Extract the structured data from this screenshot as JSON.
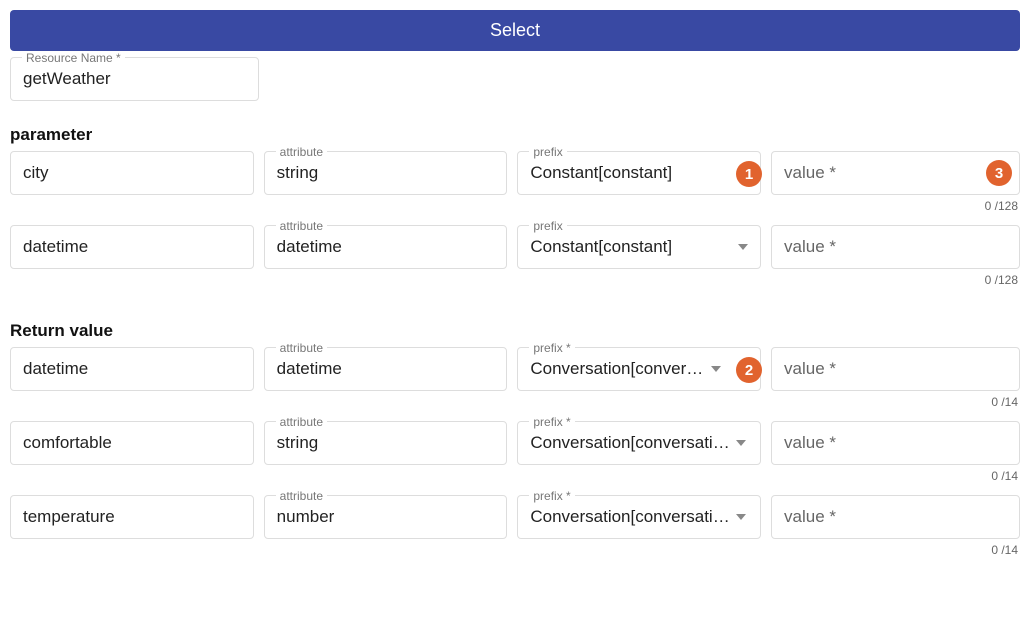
{
  "header": {
    "select_label": "Select"
  },
  "resource": {
    "label": "Resource Name *",
    "value": "getWeather"
  },
  "sections": {
    "parameter_title": "parameter",
    "return_title": "Return value"
  },
  "labels": {
    "attribute": "attribute",
    "prefix": "prefix",
    "prefix_req": "prefix *",
    "value_placeholder": "value *"
  },
  "parameters": [
    {
      "name": "city",
      "attribute": "string",
      "prefix": "Constant[constant]",
      "value": "",
      "counter": "0 /128"
    },
    {
      "name": "datetime",
      "attribute": "datetime",
      "prefix": "Constant[constant]",
      "value": "",
      "counter": "0 /128"
    }
  ],
  "returns": [
    {
      "name": "datetime",
      "attribute": "datetime",
      "prefix": "Conversation[conversation]",
      "value": "",
      "counter": "0 /14"
    },
    {
      "name": "comfortable",
      "attribute": "string",
      "prefix": "Conversation[conversation]",
      "value": "",
      "counter": "0 /14"
    },
    {
      "name": "temperature",
      "attribute": "number",
      "prefix": "Conversation[conversation]",
      "value": "",
      "counter": "0 /14"
    }
  ],
  "badges": {
    "b1": "1",
    "b2": "2",
    "b3": "3"
  }
}
